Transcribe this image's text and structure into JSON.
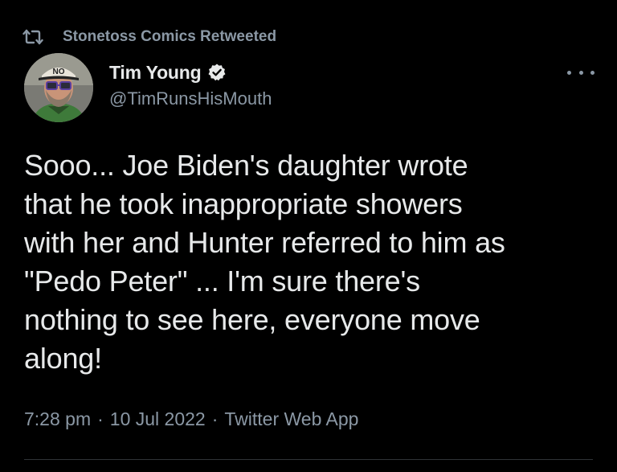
{
  "retweet": {
    "label": "Stonetoss Comics Retweeted",
    "icon": "retweet-icon"
  },
  "author": {
    "name": "Tim Young",
    "handle": "@TimRunsHisMouth",
    "verified": true,
    "avatar_cap_text": "NO",
    "icon_verified": "verified-badge-icon"
  },
  "tweet": {
    "text": "Sooo... Joe Biden's daughter wrote\nthat he took inappropriate showers\nwith her and Hunter referred to him as\n\"Pedo Peter\" ... I'm sure there's\nnothing to see here, everyone move\nalong!",
    "time": "7:28 pm",
    "date": "10 Jul 2022",
    "source": "Twitter Web App",
    "separator": "·"
  },
  "colors": {
    "background": "#000000",
    "text": "#e7e9ea",
    "muted": "#8b98a5",
    "verified": "#1d9bf0",
    "divider": "#2f3336"
  }
}
